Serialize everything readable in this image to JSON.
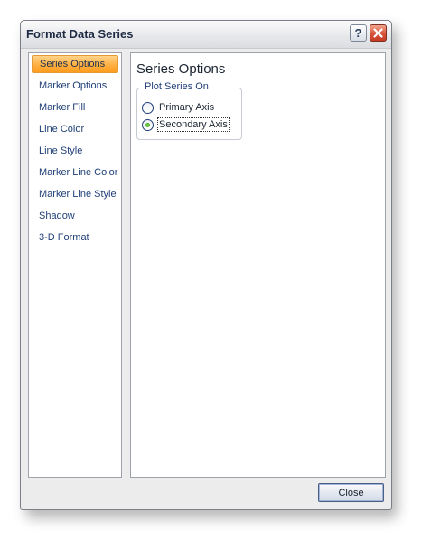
{
  "window": {
    "title": "Format Data Series",
    "help_label": "?",
    "close_icon": "close-x-icon"
  },
  "nav": {
    "selected_index": 0,
    "items": [
      {
        "label": "Series Options"
      },
      {
        "label": "Marker Options"
      },
      {
        "label": "Marker Fill"
      },
      {
        "label": "Line Color"
      },
      {
        "label": "Line Style"
      },
      {
        "label": "Marker Line Color"
      },
      {
        "label": "Marker Line Style"
      },
      {
        "label": "Shadow"
      },
      {
        "label": "3-D Format"
      }
    ]
  },
  "content": {
    "title": "Series Options",
    "plot_series_group": {
      "label": "Plot Series On",
      "options": [
        {
          "label": "Primary Axis",
          "checked": false
        },
        {
          "label": "Secondary Axis",
          "checked": true
        }
      ]
    }
  },
  "footer": {
    "close_label": "Close"
  },
  "colors": {
    "selection_orange": "#ffb042",
    "link_blue": "#1f3f78",
    "close_red": "#d6533a"
  }
}
